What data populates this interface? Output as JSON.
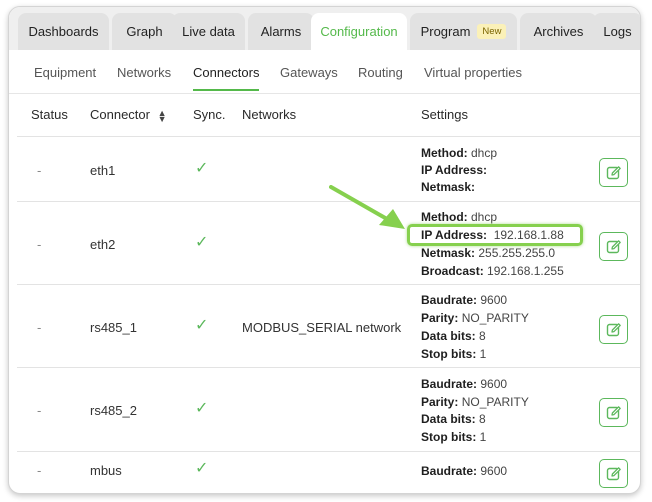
{
  "tabs": [
    {
      "label": "Dashboards"
    },
    {
      "label": "Graph"
    },
    {
      "label": "Live data"
    },
    {
      "label": "Alarms"
    },
    {
      "label": "Configuration",
      "active": true
    },
    {
      "label": "Program",
      "badge": "New"
    },
    {
      "label": "Archives"
    },
    {
      "label": "Logs"
    }
  ],
  "subtabs": [
    "Equipment",
    "Networks",
    "Connectors",
    "Gateways",
    "Routing",
    "Virtual properties"
  ],
  "active_subtab": "Connectors",
  "table": {
    "headers": {
      "status": "Status",
      "connector": "Connector",
      "sync": "Sync.",
      "networks": "Networks",
      "settings": "Settings"
    },
    "rows": [
      {
        "status": "-",
        "connector": "eth1",
        "network": "",
        "settings": [
          {
            "k": "Method:",
            "v": " dhcp"
          },
          {
            "k": "IP Address:",
            "v": ""
          },
          {
            "k": "Netmask:",
            "v": ""
          }
        ]
      },
      {
        "status": "-",
        "connector": "eth2",
        "network": "",
        "settings": [
          {
            "k": "Method:",
            "v": " dhcp"
          },
          {
            "k": "IP Address:",
            "v": "  192.168.1.88"
          },
          {
            "k": "Netmask:",
            "v": " 255.255.255.0"
          },
          {
            "k": "Broadcast:",
            "v": " 192.168.1.255"
          }
        ]
      },
      {
        "status": "-",
        "connector": "rs485_1",
        "network": "MODBUS_SERIAL network",
        "settings": [
          {
            "k": "Baudrate:",
            "v": " 9600"
          },
          {
            "k": "Parity:",
            "v": " NO_PARITY"
          },
          {
            "k": "Data bits:",
            "v": " 8"
          },
          {
            "k": "Stop bits:",
            "v": " 1"
          }
        ]
      },
      {
        "status": "-",
        "connector": "rs485_2",
        "network": "",
        "settings": [
          {
            "k": "Baudrate:",
            "v": " 9600"
          },
          {
            "k": "Parity:",
            "v": " NO_PARITY"
          },
          {
            "k": "Data bits:",
            "v": " 8"
          },
          {
            "k": "Stop bits:",
            "v": " 1"
          }
        ]
      },
      {
        "status": "-",
        "connector": "mbus",
        "network": "",
        "settings": [
          {
            "k": "Baudrate:",
            "v": " 9600"
          }
        ]
      }
    ]
  },
  "icons": {
    "sort": "sort-icon",
    "check": "check-icon",
    "edit": "edit-icon",
    "arrow": "arrow-annotation"
  },
  "colors": {
    "accent": "#54b94a",
    "highlight": "#86d04e",
    "badge_bg": "#fbf1b8"
  }
}
